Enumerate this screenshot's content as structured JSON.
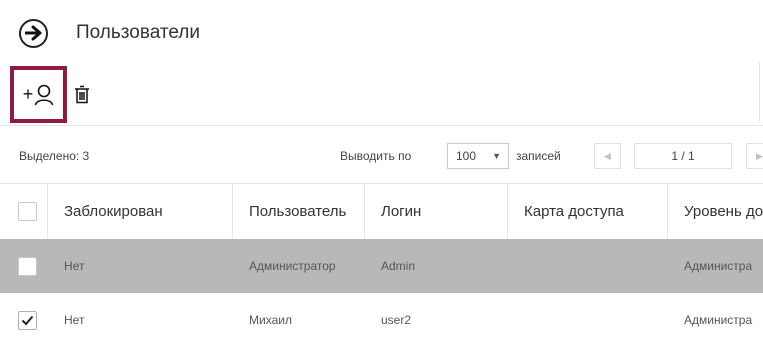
{
  "page": {
    "title": "Пользователи"
  },
  "toolbar": {
    "add_user_symbol": "+",
    "delete_label": ""
  },
  "pager": {
    "selected": "Выделено: 3",
    "per_page_label": "Выводить по",
    "per_page_value": "100",
    "records_label": "записей",
    "page_indicator": "1 / 1"
  },
  "table": {
    "headers": [
      "Заблокирован",
      "Пользователь",
      "Логин",
      "Карта доступа",
      "Уровень до"
    ],
    "rows": [
      {
        "checked": false,
        "blocked": "Нет",
        "user": "Администратор",
        "login": "Admin",
        "card": "",
        "level": "Администра"
      },
      {
        "checked": true,
        "blocked": "Нет",
        "user": "Михаил",
        "login": "user2",
        "card": "",
        "level": "Администра"
      }
    ]
  },
  "colors": {
    "accent": "#8e1b45",
    "highlight_row": "#b8b8b8"
  }
}
